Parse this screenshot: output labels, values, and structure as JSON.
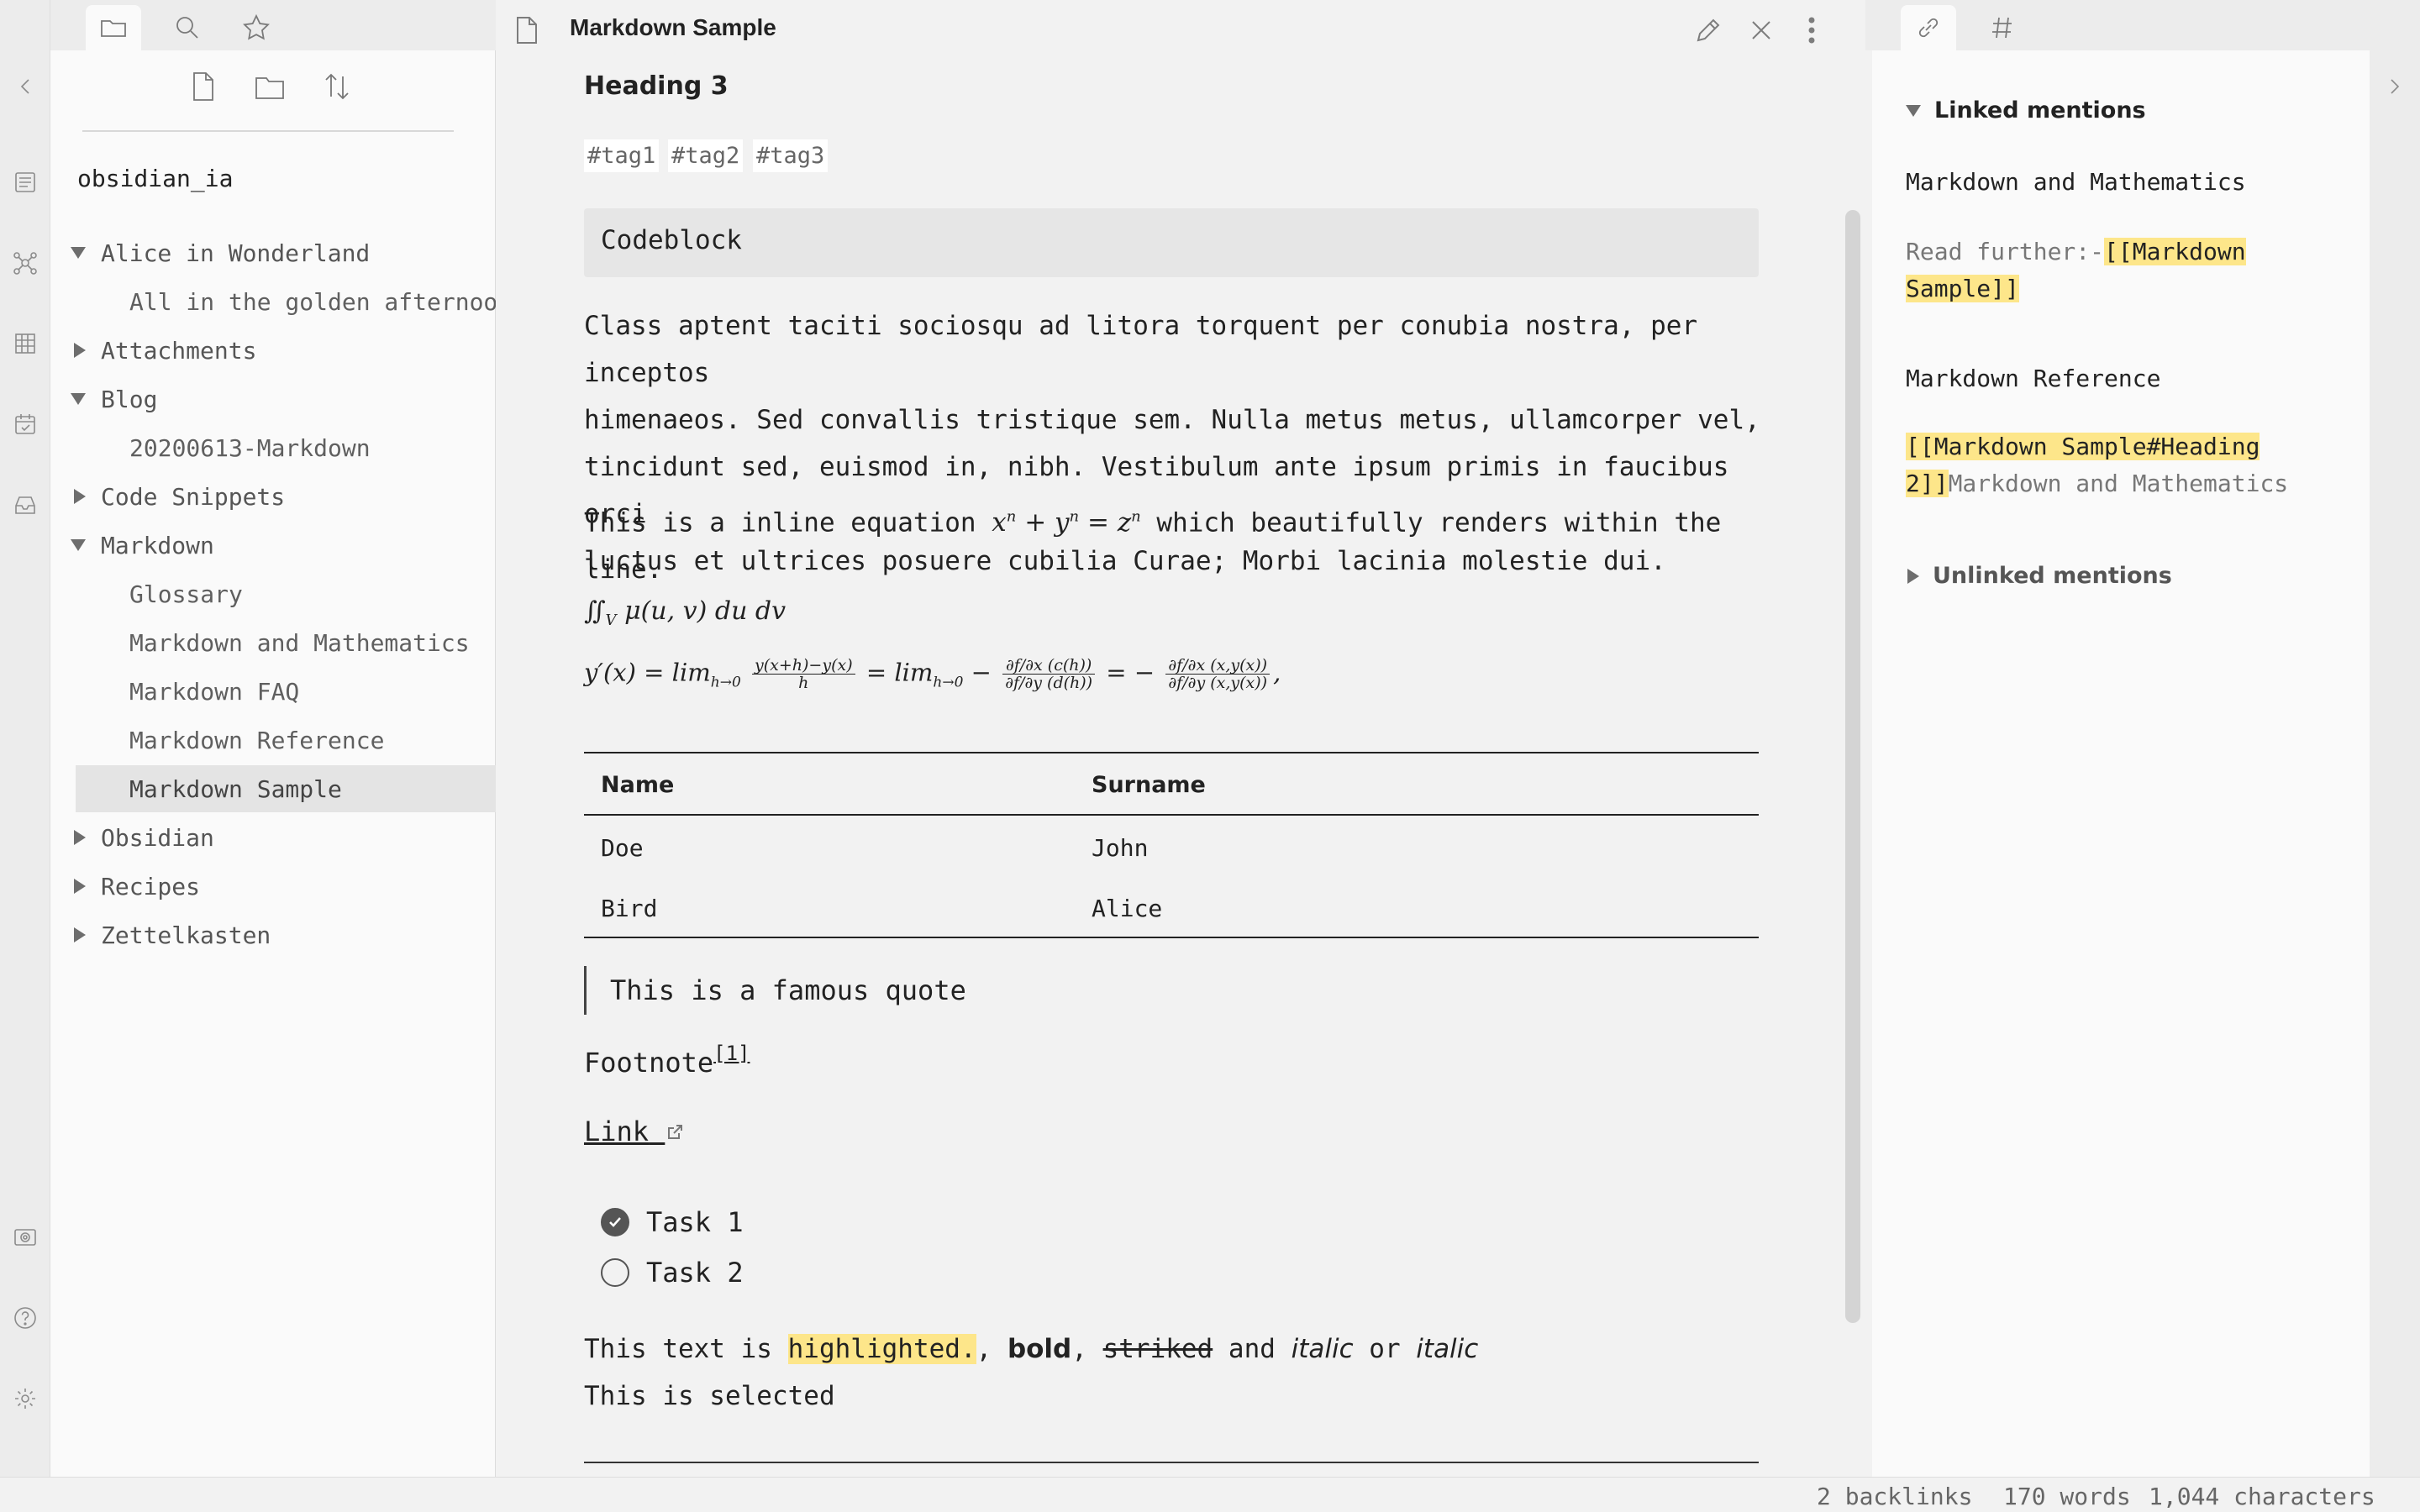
{
  "left_tabs": {
    "files_icon": "folder-icon",
    "search_icon": "search-icon",
    "starred_icon": "star-icon"
  },
  "left_panel": {
    "actions": [
      "new-note-icon",
      "new-folder-icon",
      "sort-icon"
    ],
    "vault_name": "obsidian_ia",
    "tree": [
      {
        "label": "Alice in Wonderland",
        "type": "folder",
        "expanded": true
      },
      {
        "label": "All in the golden afternoon",
        "type": "file"
      },
      {
        "label": "Attachments",
        "type": "folder",
        "expanded": false
      },
      {
        "label": "Blog",
        "type": "folder",
        "expanded": true
      },
      {
        "label": "20200613-Markdown",
        "type": "file"
      },
      {
        "label": "Code Snippets",
        "type": "folder",
        "expanded": false
      },
      {
        "label": "Markdown",
        "type": "folder",
        "expanded": true
      },
      {
        "label": "Glossary",
        "type": "file"
      },
      {
        "label": "Markdown and Mathematics",
        "type": "file"
      },
      {
        "label": "Markdown FAQ",
        "type": "file"
      },
      {
        "label": "Markdown Reference",
        "type": "file"
      },
      {
        "label": "Markdown Sample",
        "type": "file",
        "selected": true
      },
      {
        "label": "Obsidian",
        "type": "folder",
        "expanded": false
      },
      {
        "label": "Recipes",
        "type": "folder",
        "expanded": false
      },
      {
        "label": "Zettelkasten",
        "type": "folder",
        "expanded": false
      }
    ]
  },
  "main": {
    "title": "Markdown Sample",
    "heading3": "Heading 3",
    "tags": [
      "#tag1",
      "#tag2",
      "#tag3"
    ],
    "codeblock": "Codeblock",
    "paragraph_lines": [
      "Class aptent taciti sociosqu ad litora torquent per conubia nostra, per inceptos",
      "himenaeos. Sed convallis tristique sem. Nulla metus metus, ullamcorper vel,",
      "tincidunt sed, euismod in, nibh. Vestibulum ante ipsum primis in faucibus orci",
      "luctus et ultrices posuere cubilia Curae; Morbi lacinia molestie dui."
    ],
    "inline_eq_before": "This is a inline equation",
    "inline_eq_after": "which beautifully renders within the line.",
    "table": {
      "headers": [
        "Name",
        "Surname"
      ],
      "rows": [
        [
          "Doe",
          "John"
        ],
        [
          "Bird",
          "Alice"
        ]
      ]
    },
    "quote": "This is a famous quote",
    "footnote_text": "Footnote",
    "footnote_ref": "[1]",
    "link_text": "Link",
    "tasks": [
      {
        "label": "Task 1",
        "checked": true
      },
      {
        "label": "Task 2",
        "checked": false
      }
    ],
    "formatting": {
      "prefix": "This text is",
      "highlighted": "highlighted.",
      "bold": "bold",
      "striked": "striked",
      "and": "and",
      "italic1": "italic",
      "or": "or",
      "italic2": "italic"
    },
    "selected_line": "This is selected"
  },
  "right_panel": {
    "linked_header": "Linked mentions",
    "mentions": [
      {
        "file": "Markdown and Mathematics",
        "pre": "Read further:-",
        "link": "[[Markdown",
        "link2": "Sample]]"
      },
      {
        "file": "Markdown Reference",
        "link": "[[Markdown Sample#Heading",
        "link2": "2]]",
        "post": "Markdown and Mathematics"
      }
    ],
    "unlinked_header": "Unlinked mentions"
  },
  "status": {
    "backlinks": "2 backlinks",
    "words": "170 words",
    "chars": "1,044 characters"
  },
  "colors": {
    "highlight": "#fde68a",
    "accent": "#555555"
  }
}
